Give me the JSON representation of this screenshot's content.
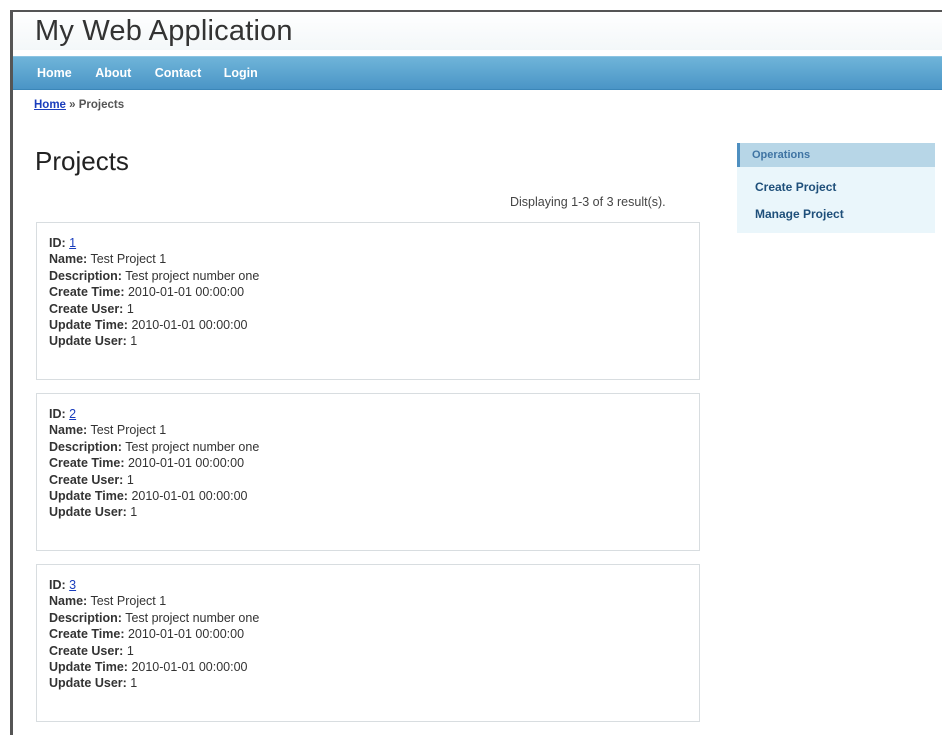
{
  "app": {
    "title": "My Web Application"
  },
  "mainmenu": {
    "items": [
      {
        "label": "Home"
      },
      {
        "label": "About"
      },
      {
        "label": "Contact"
      },
      {
        "label": "Login"
      }
    ]
  },
  "breadcrumbs": {
    "home": "Home",
    "separator": "»",
    "current": "Projects"
  },
  "page": {
    "title": "Projects",
    "summary": "Displaying 1-3 of 3 result(s)."
  },
  "labels": {
    "id": "ID:",
    "name": "Name:",
    "description": "Description:",
    "create_time": "Create Time:",
    "create_user": "Create User:",
    "update_time": "Update Time:",
    "update_user": "Update User:"
  },
  "projects": [
    {
      "id": "1",
      "name": "Test Project 1",
      "description": "Test project number one",
      "create_time": "2010-01-01 00:00:00",
      "create_user": "1",
      "update_time": "2010-01-01 00:00:00",
      "update_user": "1"
    },
    {
      "id": "2",
      "name": "Test Project 1",
      "description": "Test project number one",
      "create_time": "2010-01-01 00:00:00",
      "create_user": "1",
      "update_time": "2010-01-01 00:00:00",
      "update_user": "1"
    },
    {
      "id": "3",
      "name": "Test Project 1",
      "description": "Test project number one",
      "create_time": "2010-01-01 00:00:00",
      "create_user": "1",
      "update_time": "2010-01-01 00:00:00",
      "update_user": "1"
    }
  ],
  "operations": {
    "title": "Operations",
    "items": [
      {
        "label": "Create Project"
      },
      {
        "label": "Manage Project"
      }
    ]
  }
}
